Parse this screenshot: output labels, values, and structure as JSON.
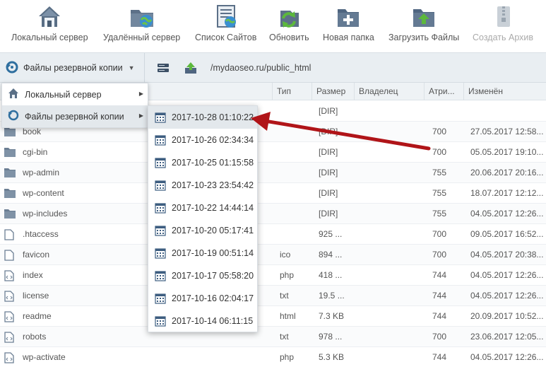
{
  "toolbar": {
    "items": [
      {
        "label": "Локальный сервер",
        "icon": "house-icon"
      },
      {
        "label": "Удалённый сервер",
        "icon": "globe-folder-icon"
      },
      {
        "label": "Список Сайтов",
        "icon": "site-list-icon"
      },
      {
        "label": "Обновить",
        "icon": "refresh-icon"
      },
      {
        "label": "Новая папка",
        "icon": "new-folder-icon"
      },
      {
        "label": "Загрузить Файлы",
        "icon": "upload-icon"
      },
      {
        "label": "Создать Архив",
        "icon": "archive-icon",
        "disabled": true
      }
    ]
  },
  "pathbar": {
    "backup_selector": "Файлы резервной копии",
    "path": "/mydaoseo.ru/public_html"
  },
  "table": {
    "headers": {
      "type": "Тип",
      "size": "Размер",
      "owner": "Владелец",
      "attr": "Атри...",
      "modified": "Изменён"
    },
    "rows": [
      {
        "name": "",
        "type": "",
        "size": "[DIR]",
        "attr": "",
        "modified": "",
        "kind": "folder"
      },
      {
        "name": "book",
        "type": "",
        "size": "[DIR]",
        "attr": "700",
        "modified": "27.05.2017 12:58...",
        "kind": "folder"
      },
      {
        "name": "cgi-bin",
        "type": "",
        "size": "[DIR]",
        "attr": "700",
        "modified": "05.05.2017 19:10...",
        "kind": "folder"
      },
      {
        "name": "wp-admin",
        "type": "",
        "size": "[DIR]",
        "attr": "755",
        "modified": "20.06.2017 20:16...",
        "kind": "folder"
      },
      {
        "name": "wp-content",
        "type": "",
        "size": "[DIR]",
        "attr": "755",
        "modified": "18.07.2017 12:12...",
        "kind": "folder"
      },
      {
        "name": "wp-includes",
        "type": "",
        "size": "[DIR]",
        "attr": "755",
        "modified": "04.05.2017 12:26...",
        "kind": "folder"
      },
      {
        "name": ".htaccess",
        "type": "",
        "size": "925 ...",
        "attr": "700",
        "modified": "09.05.2017 16:52...",
        "kind": "file"
      },
      {
        "name": "favicon",
        "type": "ico",
        "size": "894 ...",
        "attr": "700",
        "modified": "04.05.2017 20:38...",
        "kind": "file"
      },
      {
        "name": "index",
        "type": "php",
        "size": "418 ...",
        "attr": "744",
        "modified": "04.05.2017 12:26...",
        "kind": "code"
      },
      {
        "name": "license",
        "type": "txt",
        "size": "19.5 ...",
        "attr": "744",
        "modified": "04.05.2017 12:26...",
        "kind": "code"
      },
      {
        "name": "readme",
        "type": "html",
        "size": "7.3 KB",
        "attr": "744",
        "modified": "20.09.2017 10:52...",
        "kind": "code"
      },
      {
        "name": "robots",
        "type": "txt",
        "size": "978 ...",
        "attr": "700",
        "modified": "23.06.2017 12:05...",
        "kind": "code"
      },
      {
        "name": "wp-activate",
        "type": "php",
        "size": "5.3 KB",
        "attr": "744",
        "modified": "04.05.2017 12:26...",
        "kind": "code"
      }
    ]
  },
  "menu": {
    "level1": [
      {
        "label": "Локальный сервер",
        "icon": "house-icon"
      },
      {
        "label": "Файлы резервной копии",
        "icon": "backup-icon",
        "active": true
      }
    ],
    "backups": [
      "2017-10-28 01:10:22",
      "2017-10-26 02:34:34",
      "2017-10-25 01:15:58",
      "2017-10-23 23:54:42",
      "2017-10-22 14:44:14",
      "2017-10-20 05:17:41",
      "2017-10-19 00:51:14",
      "2017-10-17 05:58:20",
      "2017-10-16 02:04:17",
      "2017-10-14 06:11:15"
    ]
  },
  "colors": {
    "annotation_arrow": "#b01418",
    "accent": "#2f6f9f"
  }
}
